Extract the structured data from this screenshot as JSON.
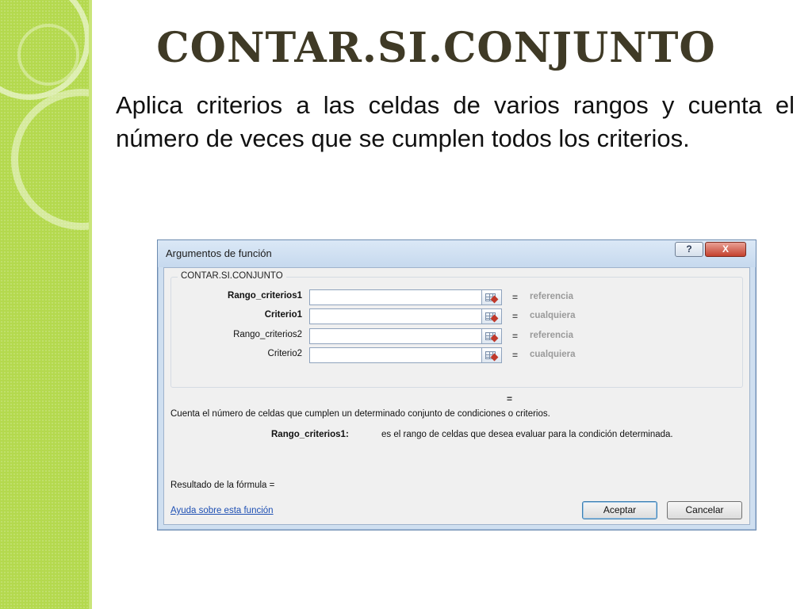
{
  "slide": {
    "title": "CONTAR.SI.CONJUNTO",
    "body": "Aplica criterios a las celdas de varios rangos y cuenta el número de veces que se cumplen todos los criterios."
  },
  "dialog": {
    "title": "Argumentos de función",
    "help_button": "?",
    "close_button": "X",
    "group_label": "CONTAR.SI.CONJUNTO",
    "args": [
      {
        "label": "Rango_criterios1",
        "bold": true,
        "value": "",
        "eq": "=",
        "hint": "referencia"
      },
      {
        "label": "Criterio1",
        "bold": true,
        "value": "",
        "eq": "=",
        "hint": "cualquiera"
      },
      {
        "label": "Rango_criterios2",
        "bold": false,
        "value": "",
        "eq": "=",
        "hint": "referencia"
      },
      {
        "label": "Criterio2",
        "bold": false,
        "value": "",
        "eq": "=",
        "hint": "cualquiera"
      }
    ],
    "result_eq": "=",
    "description": "Cuenta el número de celdas que cumplen un determinado conjunto de condiciones o criterios.",
    "arg_description_name": "Rango_criterios1:",
    "arg_description_text": "es el rango de celdas que desea evaluar para la condición determinada.",
    "formula_result_label": "Resultado de la fórmula =",
    "help_link": "Ayuda sobre esta función",
    "ok_button": "Aceptar",
    "cancel_button": "Cancelar"
  },
  "colors": {
    "side_band": "#b4d94e",
    "title_text": "#3f3a26",
    "link": "#1d4fb3"
  }
}
